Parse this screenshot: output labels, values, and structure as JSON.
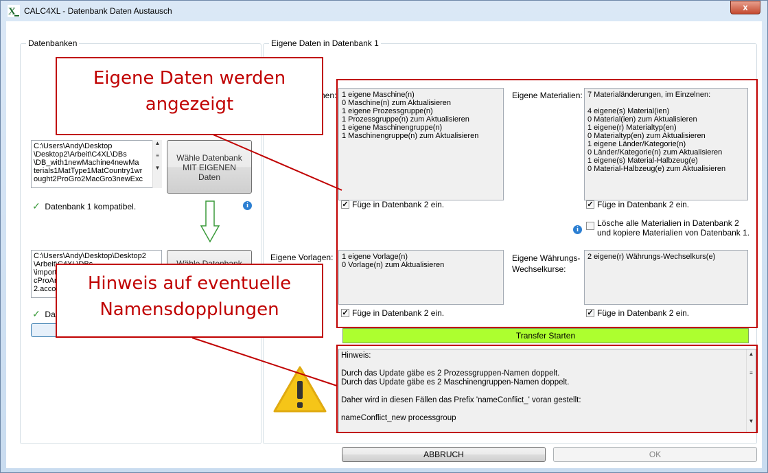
{
  "window": {
    "title": "CALC4XL - Datenbank Daten Austausch",
    "close_label": "x"
  },
  "left_panel": {
    "legend": "Datenbanken",
    "db1_path": "C:\\Users\\Andy\\Desktop\n\\Desktop2\\Arbeit\\C4XL\\DBs\n\\DB_with1newMachine4newMa\nterials1MatType1MatCountry1wr\nought2ProGro2MacGro3newExc",
    "db1_button": "Wähle Datenbank\nMIT EIGENEN\nDaten",
    "db1_status": "Datenbank 1 kompatibel.",
    "db2_path": "C:\\Users\\Andy\\Desktop\\Desktop2\n\\Arbeit\\C4XL\\DBs\n\\import\ncProAr\n2.acco",
    "db2_button": "Wähle Datenbank",
    "db2_status": "Da"
  },
  "right_panel": {
    "legend": "Eigene Daten in Datenbank 1",
    "machines_label": "nen:",
    "machines_box": "1 eigene Maschine(n)\n0 Maschine(n) zum Aktualisieren\n1 eigene Prozessgruppe(n)\n1 Prozessgruppe(n) zum Aktualisieren\n1 eigene Maschinengruppe(n)\n1 Maschinengruppe(n) zum Aktualisieren",
    "materials_label": "Eigene Materialien:",
    "materials_box": "7 Materialänderungen, im Einzelnen:\n\n4 eigene(s) Material(ien)\n0 Material(ien) zum Aktualisieren\n1 eigene(r) Materialtyp(en)\n0 Materialtyp(en) zum Aktualisieren\n1 eigene Länder/Kategorie(n)\n0 Länder/Kategorie(n) zum Aktualisieren\n1 eigene(s) Material-Halbzeug(e)\n0 Material-Halbzeug(e) zum Aktualisieren",
    "insert_label": "Füge in Datenbank 2 ein.",
    "delete_materials_label": "Lösche alle Materialien in Datenbank 2\nund kopiere Materialien von Datenbank 1.",
    "templates_label": "Eigene Vorlagen:",
    "templates_box": "1 eigene Vorlage(n)\n0 Vorlage(n) zum Aktualisieren",
    "currency_label": "Eigene Währungs-\nWechselkurse:",
    "currency_box": "2 eigene(r) Währungs-Wechselkurs(e)",
    "transfer_button": "Transfer Starten",
    "hint_lines": [
      "Hinweis:",
      "",
      "Durch das Update gäbe es 2 Prozessgruppen-Namen doppelt.",
      "Durch das Update gäbe es 2 Maschinengruppen-Namen doppelt.",
      "",
      "Daher wird in diesen Fällen das Prefix 'nameConflict_' voran gestellt:",
      "",
      "nameConflict_new processgroup"
    ]
  },
  "footer": {
    "cancel_button": "ABBRUCH",
    "ok_button": "OK"
  },
  "callouts": {
    "data_shown": "Eigene Daten werden\nangezeigt",
    "name_duplicates": "Hinweis auf eventuelle\nNamensdopplungen"
  },
  "colors": {
    "annotation_red": "#c00000",
    "transfer_green": "#adff2f",
    "warning_yellow": "#f5c518"
  }
}
